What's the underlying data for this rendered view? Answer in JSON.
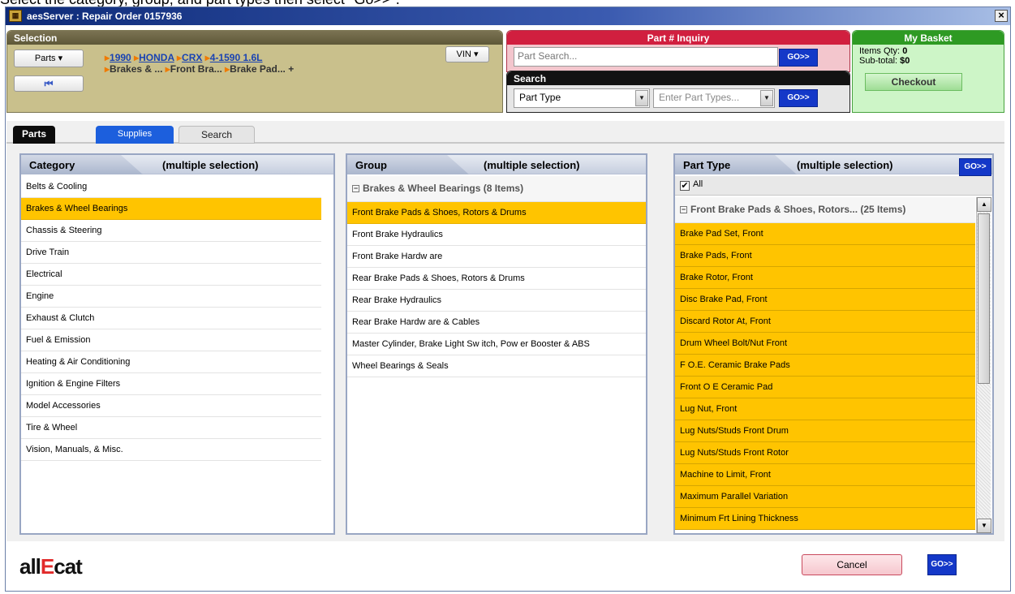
{
  "instruction": "Select the category, group, and part types then select \"Go>>\".",
  "window": {
    "title": "aesServer : Repair Order 0157936",
    "close": "×",
    "icon": "app-icon"
  },
  "selection": {
    "title": "Selection",
    "parts_dropdown": "Parts",
    "first_button": "⏮",
    "vin_dropdown": "VIN",
    "vehicle": {
      "year": "1990",
      "make": "HONDA",
      "model": "CRX",
      "engine": "4-1590 1.6L"
    },
    "category_path": [
      "Brakes & ...",
      "Front Bra...",
      "Brake Pad..."
    ],
    "more": "+"
  },
  "part_inquiry": {
    "title": "Part # Inquiry",
    "placeholder": "Part Search...",
    "go": "GO>>"
  },
  "search": {
    "title": "Search",
    "type_value": "Part Type",
    "types_placeholder": "Enter Part Types...",
    "go": "GO>>"
  },
  "basket": {
    "title": "My Basket",
    "items_label": "Items Qty:",
    "items_value": "0",
    "subtotal_label": "Sub-total:",
    "subtotal_value": "$0",
    "checkout": "Checkout"
  },
  "tabs": [
    "Parts",
    "Supplies",
    "Search"
  ],
  "category": {
    "title": "Category",
    "mode": "(multiple selection)",
    "items": [
      "Belts & Cooling",
      "Brakes & Wheel Bearings",
      "Chassis & Steering",
      "Drive Train",
      "Electrical",
      "Engine",
      "Exhaust & Clutch",
      "Fuel & Emission",
      "Heating & Air Conditioning",
      "Ignition & Engine Filters",
      "Model Accessories",
      "Tire & Wheel",
      "Vision, Manuals, & Misc."
    ],
    "selected": "Brakes & Wheel Bearings"
  },
  "group": {
    "title": "Group",
    "mode": "(multiple selection)",
    "header": "Brakes & Wheel Bearings (8 Items)",
    "items": [
      "Front Brake Pads & Shoes, Rotors & Drums",
      "Front Brake Hydraulics",
      "Front Brake Hardw are",
      "Rear Brake Pads & Shoes, Rotors & Drums",
      "Rear Brake Hydraulics",
      "Rear Brake Hardw are & Cables",
      "Master Cylinder, Brake Light Sw itch, Pow er Booster & ABS",
      "Wheel Bearings & Seals"
    ],
    "selected": "Front Brake Pads & Shoes, Rotors & Drums"
  },
  "part_type": {
    "title": "Part Type",
    "mode": "(multiple selection)",
    "go": "GO>>",
    "all_label": "All",
    "all_checked": true,
    "header": "Front Brake Pads & Shoes, Rotors... (25 Items)",
    "items": [
      "Brake Pad Set, Front",
      "Brake Pads, Front",
      "Brake Rotor, Front",
      "Disc Brake Pad, Front",
      "Discard Rotor At, Front",
      "Drum Wheel Bolt/Nut Front",
      "F O.E. Ceramic Brake Pads",
      "Front O E Ceramic Pad",
      "Lug Nut, Front",
      "Lug Nuts/Studs Front Drum",
      "Lug Nuts/Studs Front Rotor",
      "Machine to Limit, Front",
      "Maximum Parallel Variation",
      "Minimum Frt Lining Thickness"
    ]
  },
  "footer": {
    "logo_a": "all",
    "logo_e": "E",
    "logo_b": "cat",
    "cancel": "Cancel",
    "go": "GO>>"
  },
  "colors": {
    "selected_row": "#ffc400",
    "go_button": "#1438c8",
    "inquiry": "#d11f3f",
    "basket": "#2e9a23"
  }
}
